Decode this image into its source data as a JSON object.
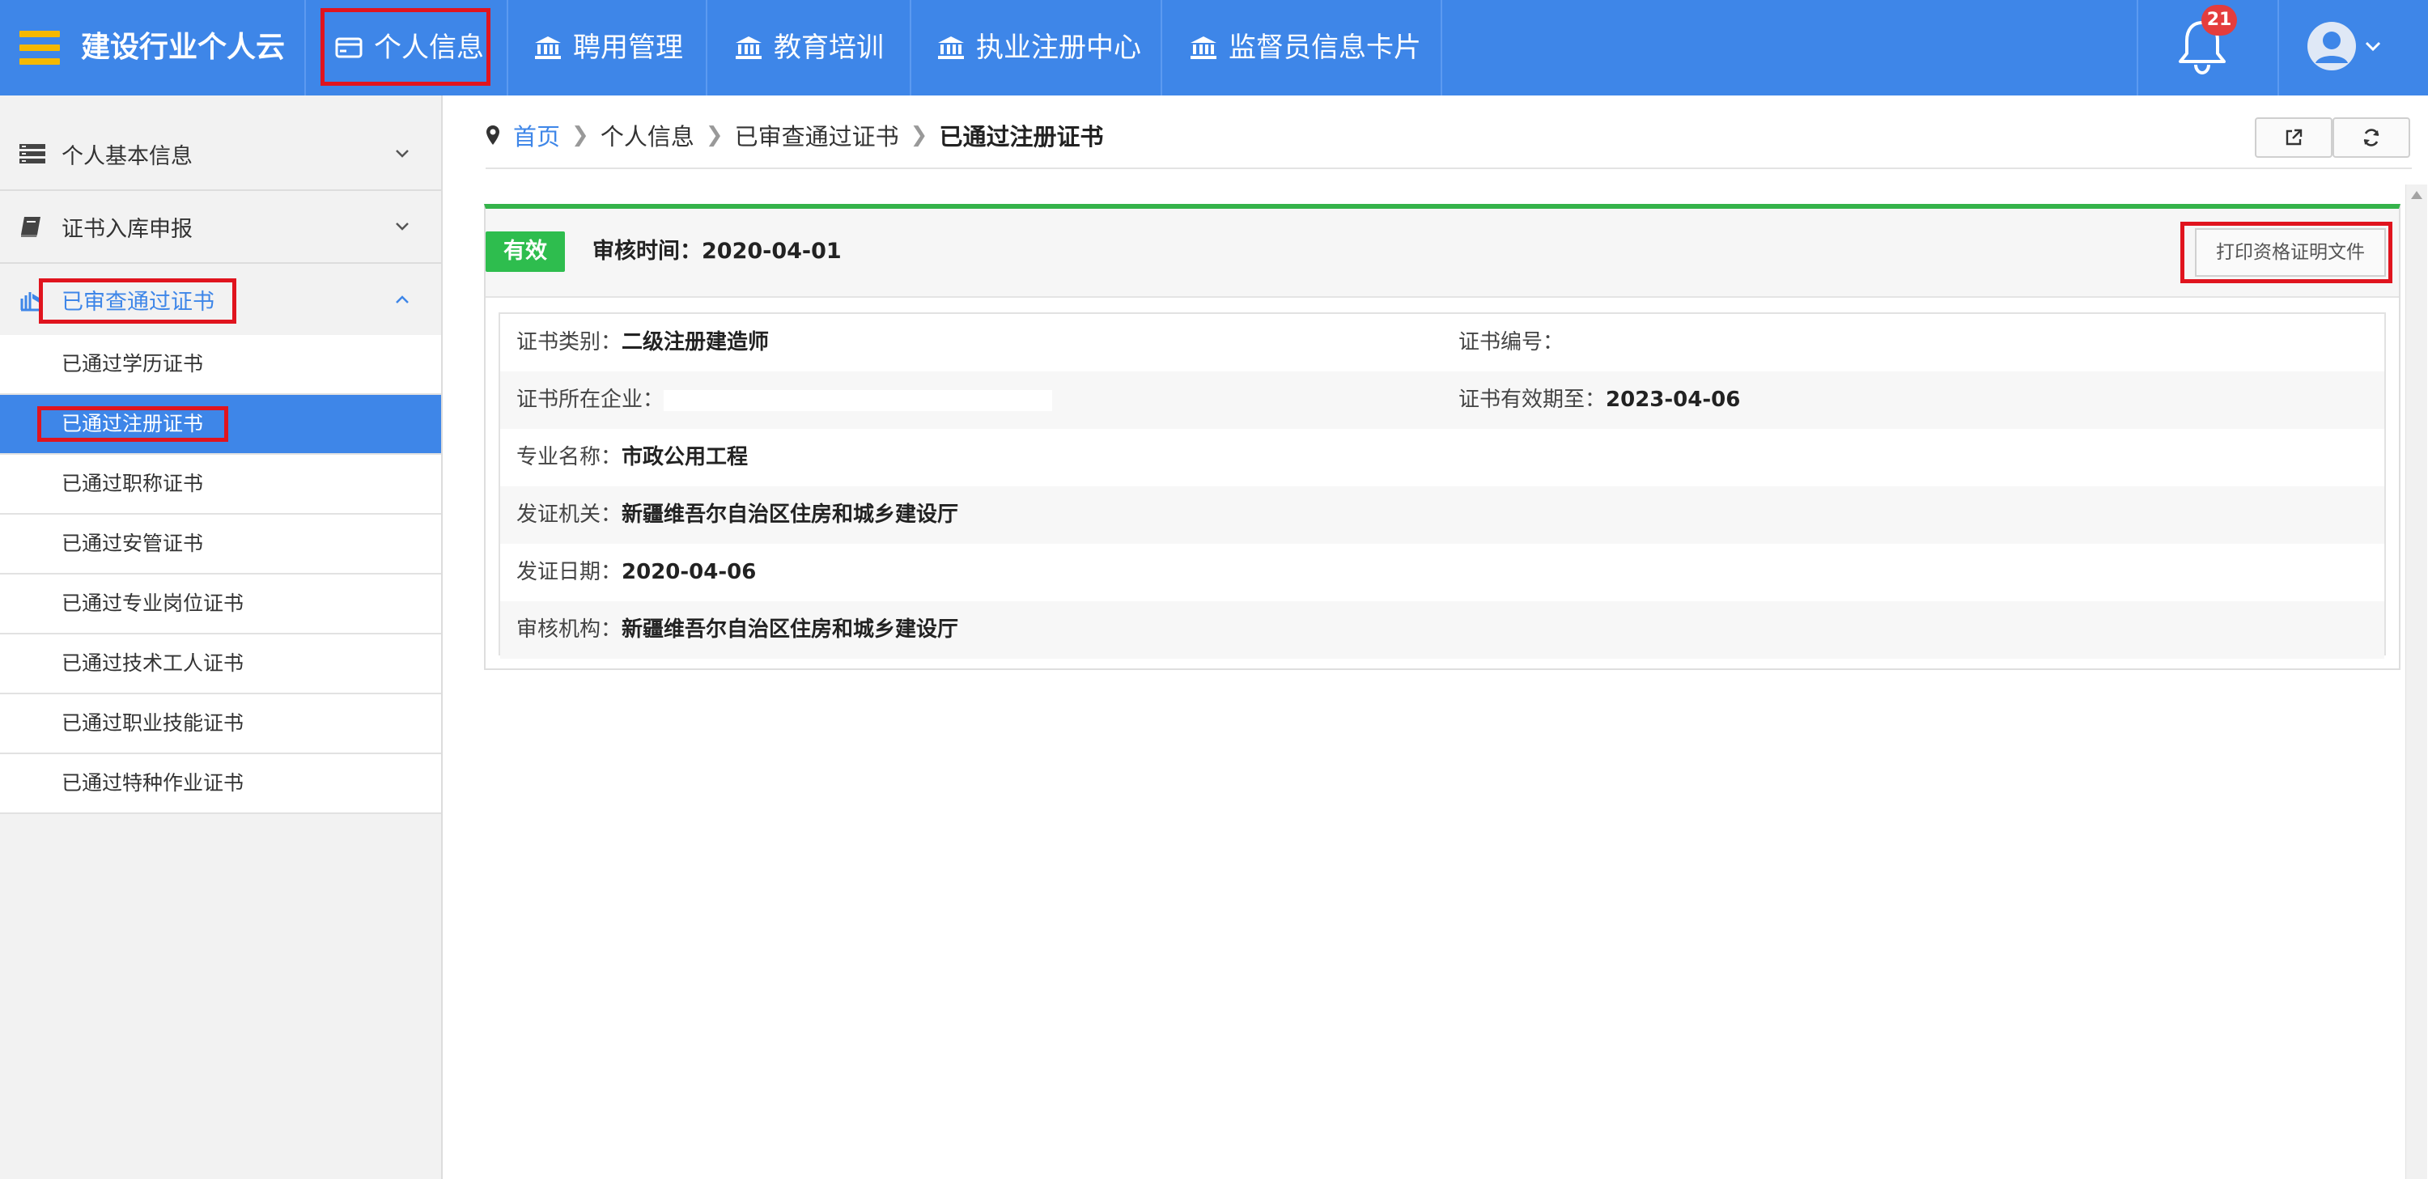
{
  "header": {
    "app_title": "建设行业个人云",
    "nav": [
      {
        "label": "个人信息",
        "icon": "id-card-icon"
      },
      {
        "label": "聘用管理",
        "icon": "bank-icon"
      },
      {
        "label": "教育培训",
        "icon": "bank-icon"
      },
      {
        "label": "执业注册中心",
        "icon": "bank-icon"
      },
      {
        "label": "监督员信息卡片",
        "icon": "bank-icon"
      }
    ],
    "notification_count": "21"
  },
  "sidebar": {
    "groups": [
      {
        "label": "个人基本信息",
        "icon": "list-icon"
      },
      {
        "label": "证书入库申报",
        "icon": "book-icon"
      },
      {
        "label": "已审查通过证书",
        "icon": "stack-icon"
      }
    ],
    "sub_items": [
      {
        "label": "已通过学历证书"
      },
      {
        "label": "已通过注册证书"
      },
      {
        "label": "已通过职称证书"
      },
      {
        "label": "已通过安管证书"
      },
      {
        "label": "已通过专业岗位证书"
      },
      {
        "label": "已通过技术工人证书"
      },
      {
        "label": "已通过职业技能证书"
      },
      {
        "label": "已通过特种作业证书"
      }
    ]
  },
  "breadcrumb": {
    "home": "首页",
    "level1": "个人信息",
    "level2": "已审查通过证书",
    "current": "已通过注册证书"
  },
  "certificate": {
    "status": "有效",
    "audit_time_label": "审核时间：",
    "audit_time": "2020-04-01",
    "print_button": "打印资格证明文件",
    "fields": {
      "category_label": "证书类别：",
      "category": "二级注册建造师",
      "number_label": "证书编号：",
      "number": "",
      "company_label": "证书所在企业：",
      "company": "",
      "valid_until_label": "证书有效期至：",
      "valid_until": "2023-04-06",
      "major_label": "专业名称：",
      "major": "市政公用工程",
      "issuer_label": "发证机关：",
      "issuer": "新疆维吾尔自治区住房和城乡建设厅",
      "issue_date_label": "发证日期：",
      "issue_date": "2020-04-06",
      "reviewer_label": "审核机构：",
      "reviewer": "新疆维吾尔自治区住房和城乡建设厅"
    }
  },
  "colors": {
    "brand_blue": "#3e86e8",
    "valid_green": "#2ebd4e",
    "highlight_red": "#e0141e",
    "menu_accent": "#f5b800"
  }
}
